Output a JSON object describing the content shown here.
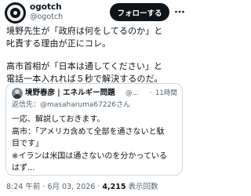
{
  "author": {
    "display_name": "ogotch",
    "handle": "@ogotch",
    "follow_label": "フォローする"
  },
  "tweet": {
    "lines_para1": [
      "境野先生が「政府は何をしてるのか」と",
      "叱責する理由が正にコレ。"
    ],
    "lines_para2": [
      "高市首相が「日本は通してください」と",
      "電話一本入れれば５秒で解決するのだ。"
    ]
  },
  "quote": {
    "display_name": "境野春彦 | エネルギー問題",
    "handle": "@...",
    "separator": "·",
    "time": "11時間",
    "reply_prefix": "返信先：",
    "reply_to": "@masaharuma67226さん",
    "body_lines": [
      "一応、解説しておきます。",
      "高市：「アメリカ含めて全部を通さないと駄",
      "目です」",
      "※イランは米国は通さないのを分かっている",
      "はず..."
    ]
  },
  "footer": {
    "time": "8:24 午前",
    "dot1": "·",
    "date": "6月 03, 2026",
    "dot2": "·",
    "views_count": "4,215",
    "views_label": "表示回数"
  },
  "icons": {
    "more": "more-horizontal-icon",
    "avatar": "profile-avatar"
  },
  "colors": {
    "text": "#0f1419",
    "secondary": "#536471",
    "border": "#cfd9de",
    "follow_bg": "#0f1419"
  }
}
